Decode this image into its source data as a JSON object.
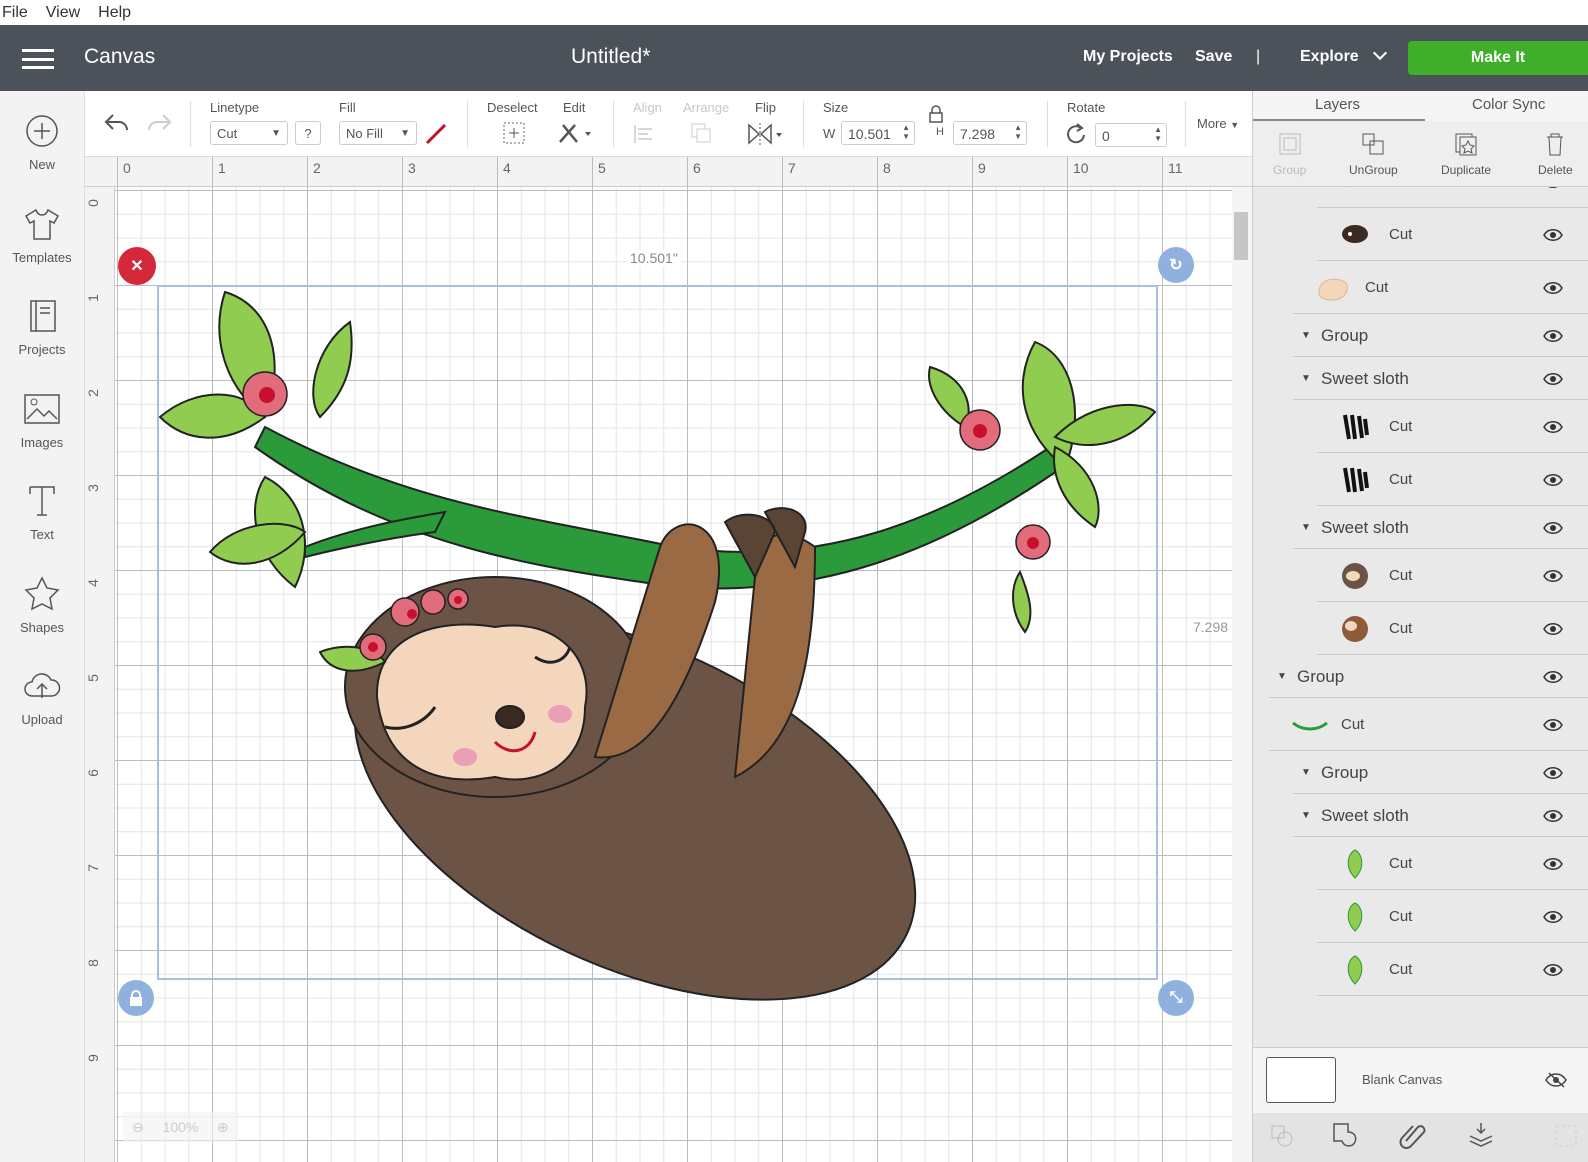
{
  "menu": [
    "File",
    "View",
    "Help"
  ],
  "header": {
    "app_title": "Canvas",
    "doc_title": "Untitled*",
    "my_projects": "My Projects",
    "save": "Save",
    "divider": "|",
    "explore": "Explore",
    "make_it": "Make It"
  },
  "sidebar": [
    {
      "label": "New",
      "icon": "plus-circle-icon"
    },
    {
      "label": "Templates",
      "icon": "shirt-icon"
    },
    {
      "label": "Projects",
      "icon": "book-icon"
    },
    {
      "label": "Images",
      "icon": "image-icon"
    },
    {
      "label": "Text",
      "icon": "text-icon"
    },
    {
      "label": "Shapes",
      "icon": "shapes-icon"
    },
    {
      "label": "Upload",
      "icon": "cloud-upload-icon"
    }
  ],
  "toolbar": {
    "linetype_label": "Linetype",
    "linetype_value": "Cut",
    "help": "?",
    "fill_label": "Fill",
    "fill_value": "No Fill",
    "deselect": "Deselect",
    "edit": "Edit",
    "align": "Align",
    "arrange": "Arrange",
    "flip": "Flip",
    "size": "Size",
    "w_label": "W",
    "w_value": "10.501",
    "h_label": "H",
    "h_value": "7.298",
    "rotate": "Rotate",
    "rotate_value": "0",
    "more": "More"
  },
  "ruler_h": [
    "0",
    "1",
    "2",
    "3",
    "4",
    "5",
    "6",
    "7",
    "8",
    "9",
    "10",
    "11"
  ],
  "ruler_v": [
    "0",
    "1",
    "2",
    "3",
    "4",
    "5",
    "6",
    "7",
    "8",
    "9"
  ],
  "canvas": {
    "width_label": "10.501\"",
    "height_label": "7.298",
    "zoom": "100%"
  },
  "panel": {
    "tabs": [
      "Layers",
      "Color Sync"
    ],
    "tools": [
      "Group",
      "UnGroup",
      "Duplicate",
      "Delete"
    ],
    "layers": [
      {
        "label": "Cut",
        "indent": 2,
        "thumb": "dark",
        "arrow": false
      },
      {
        "label": "Cut",
        "indent": 2,
        "thumb": "nose",
        "arrow": false
      },
      {
        "label": "Cut",
        "indent": 1,
        "thumb": "face",
        "arrow": false
      },
      {
        "label": "Group",
        "indent": 1,
        "arrow": true
      },
      {
        "label": "Sweet sloth",
        "indent": 1,
        "arrow": true
      },
      {
        "label": "Cut",
        "indent": 2,
        "thumb": "claw",
        "arrow": false
      },
      {
        "label": "Cut",
        "indent": 2,
        "thumb": "claw",
        "arrow": false
      },
      {
        "label": "Sweet sloth",
        "indent": 1,
        "arrow": true
      },
      {
        "label": "Cut",
        "indent": 2,
        "thumb": "sloth1",
        "arrow": false
      },
      {
        "label": "Cut",
        "indent": 2,
        "thumb": "sloth2",
        "arrow": false
      },
      {
        "label": "Group",
        "indent": 0,
        "arrow": true
      },
      {
        "label": "Cut",
        "indent": 0,
        "thumb": "branch",
        "arrow": false
      },
      {
        "label": "Group",
        "indent": 1,
        "arrow": true
      },
      {
        "label": "Sweet sloth",
        "indent": 1,
        "arrow": true
      },
      {
        "label": "Cut",
        "indent": 2,
        "thumb": "leaf",
        "arrow": false
      },
      {
        "label": "Cut",
        "indent": 2,
        "thumb": "leaf",
        "arrow": false
      },
      {
        "label": "Cut",
        "indent": 2,
        "thumb": "leaf",
        "arrow": false
      }
    ],
    "blank_canvas": "Blank Canvas"
  },
  "colors": {
    "header": "#4b5259",
    "make_it": "#3fae29",
    "selection": "#9db7dc"
  }
}
